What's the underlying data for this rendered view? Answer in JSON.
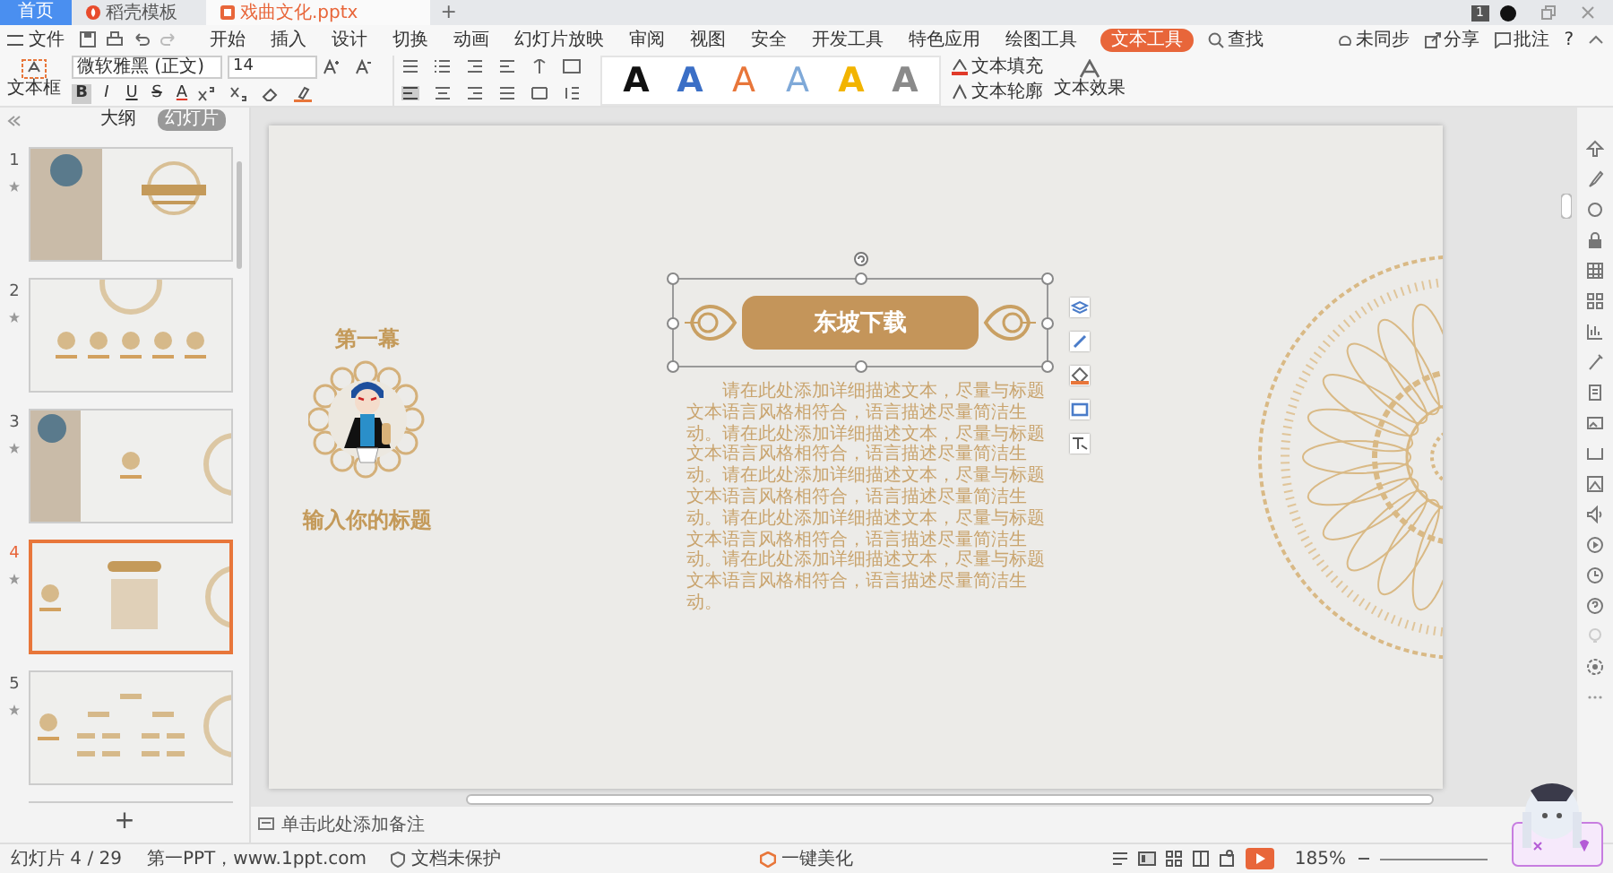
{
  "tabs": [
    {
      "label": "首页",
      "kind": "home",
      "selected": false
    },
    {
      "label": "稻壳模板",
      "kind": "docer",
      "selected": false
    },
    {
      "label": "戏曲文化.pptx",
      "kind": "file",
      "selected": true
    }
  ],
  "window": {
    "new_tab": "+",
    "badge": "1"
  },
  "menu": {
    "file": "文件",
    "items": [
      {
        "label": "开始",
        "selected": false
      },
      {
        "label": "插入",
        "selected": false
      },
      {
        "label": "设计",
        "selected": false
      },
      {
        "label": "切换",
        "selected": false
      },
      {
        "label": "动画",
        "selected": false
      },
      {
        "label": "幻灯片放映",
        "selected": false
      },
      {
        "label": "审阅",
        "selected": false
      },
      {
        "label": "视图",
        "selected": false
      },
      {
        "label": "安全",
        "selected": false
      },
      {
        "label": "开发工具",
        "selected": false
      },
      {
        "label": "特色应用",
        "selected": false
      },
      {
        "label": "绘图工具",
        "selected": false
      },
      {
        "label": "文本工具",
        "selected": true
      }
    ],
    "search": "查找",
    "sync": "未同步",
    "share": "分享",
    "comment": "批注",
    "help": "?"
  },
  "ribbon": {
    "textbox": "文本框",
    "font": "微软雅黑 (正文)",
    "size": "14",
    "format_buttons": [
      {
        "label": "B",
        "selected": true
      },
      {
        "label": "I",
        "selected": false
      },
      {
        "label": "U",
        "selected": false
      },
      {
        "label": "S",
        "selected": false
      },
      {
        "label": "A",
        "selected": false
      }
    ],
    "styles": [
      {
        "letter": "A",
        "kind": "solid",
        "color": "#111111"
      },
      {
        "letter": "A",
        "kind": "solid",
        "color": "#3b6fc6"
      },
      {
        "letter": "A",
        "kind": "outline",
        "color": "#e8763a"
      },
      {
        "letter": "A",
        "kind": "outline",
        "color": "#7fa9d8"
      },
      {
        "letter": "A",
        "kind": "solid",
        "color": "#f2b400"
      },
      {
        "letter": "A",
        "kind": "solid",
        "color": "#8a8a8a"
      }
    ],
    "fill": "文本填充",
    "outline": "文本轮廓",
    "effect": "文本效果"
  },
  "panel": {
    "view_tabs": [
      {
        "label": "大纲",
        "selected": false
      },
      {
        "label": "幻灯片",
        "selected": true
      }
    ],
    "slides": [
      {
        "number": "1",
        "kind": "cover",
        "selected": false
      },
      {
        "number": "2",
        "kind": "overview",
        "selected": false
      },
      {
        "number": "3",
        "kind": "section",
        "selected": false
      },
      {
        "number": "4",
        "kind": "content",
        "selected": true
      },
      {
        "number": "5",
        "kind": "chart",
        "selected": false
      }
    ],
    "add": "+"
  },
  "slide": {
    "section": "第一幕",
    "caption": "输入你的标题",
    "title": "东坡下载",
    "body": "请在此处添加详细描述文本，尽量与标题文本语言风格相符合，语言描述尽量简洁生动。请在此处添加详细描述文本，尽量与标题文本语言风格相符合，语言描述尽量简洁生动。请在此处添加详细描述文本，尽量与标题文本语言风格相符合，语言描述尽量简洁生动。请在此处添加详细描述文本，尽量与标题文本语言风格相符合，语言描述尽量简洁生动。请在此处添加详细描述文本，尽量与标题文本语言风格相符合，语言描述尽量简洁生动。"
  },
  "notes": {
    "placeholder": "单击此处添加备注"
  },
  "status_bar": {
    "slide": "幻灯片 4 / 29",
    "theme": "第一PPT，www.1ppt.com",
    "protect": "文档未保护",
    "beautify": "一键美化",
    "zoom": "185%"
  }
}
